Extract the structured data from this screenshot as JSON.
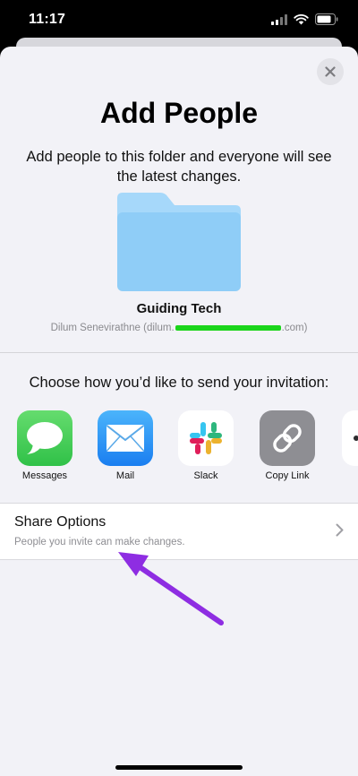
{
  "status_bar": {
    "time": "11:17"
  },
  "sheet": {
    "title": "Add People",
    "description": "Add people to this folder and everyone will see the latest changes.",
    "folder_name": "Guiding Tech",
    "owner_name": "Dilum Senevirathne (dilum.",
    "owner_email_end": ".com)",
    "choose_label": "Choose how you’d like to send your invitation:"
  },
  "apps": [
    {
      "label": "Messages",
      "icon": "messages-icon"
    },
    {
      "label": "Mail",
      "icon": "mail-icon"
    },
    {
      "label": "Slack",
      "icon": "slack-icon"
    },
    {
      "label": "Copy Link",
      "icon": "link-icon"
    }
  ],
  "share_options": {
    "title": "Share Options",
    "subtitle": "People you invite can make changes."
  },
  "colors": {
    "annotation_arrow": "#8e2de2",
    "redaction": "#1bd51b",
    "messages_green": "#34c759",
    "mail_blue": "#2f9bf6",
    "folder_blue": "#8fcdf7"
  }
}
